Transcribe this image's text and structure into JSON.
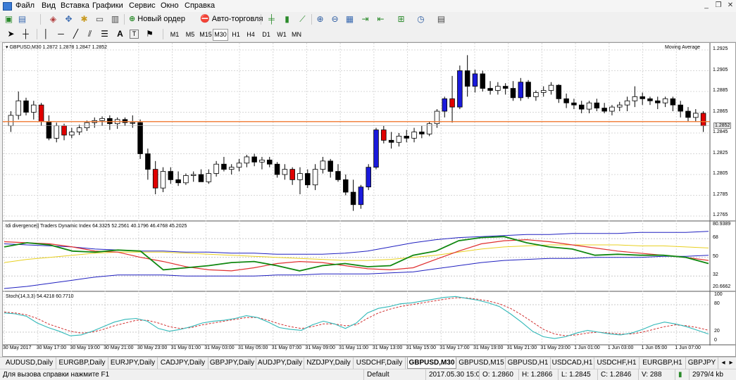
{
  "menu": [
    "Файл",
    "Вид",
    "Вставка",
    "Графики",
    "Сервис",
    "Окно",
    "Справка"
  ],
  "window_controls": {
    "minimize": "_",
    "restore": "❐",
    "close": "✕"
  },
  "toolbar1": {
    "new_order": "Новый ордер",
    "autotrading": "Авто-торговля"
  },
  "timeframes": [
    "M1",
    "M5",
    "M15",
    "M30",
    "H1",
    "H4",
    "D1",
    "W1",
    "MN"
  ],
  "active_timeframe": "M30",
  "drawing_tools": {
    "text_tool": "A",
    "label_tool": "T"
  },
  "chart": {
    "symbol_info": "GBPUSD,M30  1.2872 1.2878 1.2847 1.2852",
    "indicator_name": "Moving Average",
    "current_price": "1.2852",
    "price_ticks": [
      "1.2925",
      "1.2905",
      "1.2885",
      "1.2865",
      "1.2845",
      "1.2825",
      "1.2805",
      "1.2785",
      "1.2765"
    ],
    "tdi_label": "tdi divergence|| Traders Dynamic Index 64.3325 52.2561 40.1796 46.4768 45.2025",
    "tdi_ticks": [
      "80.9389",
      "68",
      "50",
      "32",
      "20.6662"
    ],
    "stoch_label": "Stoch(14,3,3) 54.4218 60.7710",
    "stoch_ticks": [
      "100",
      "80",
      "20",
      "0"
    ],
    "time_labels": [
      "30 May 2017",
      "30 May 17:00",
      "30 May 19:00",
      "30 May 21:00",
      "30 May 23:00",
      "31 May 01:00",
      "31 May 03:00",
      "31 May 05:00",
      "31 May 07:00",
      "31 May 09:00",
      "31 May 11:00",
      "31 May 13:00",
      "31 May 15:00",
      "31 May 17:00",
      "31 May 19:00",
      "31 May 21:00",
      "31 May 23:00",
      "1 Jun 01:00",
      "1 Jun 03:00",
      "1 Jun 05:00",
      "1 Jun 07:00"
    ],
    "colors": {
      "bull": "#ffffff",
      "bear": "#000000",
      "bear_signal": "#e00000",
      "bull_signal": "#1a1adc",
      "ma_line": "#f07830",
      "rsi": "#118811",
      "signal": "#e03030",
      "band": "#2020c0",
      "mid": "#e8d020"
    },
    "candles_data": {
      "comment": "OHLC approximations, read from the price axis",
      "ohlc": [
        [
          1.2852,
          1.2866,
          1.2846,
          1.2862
        ],
        [
          1.2862,
          1.2885,
          1.2858,
          1.2876
        ],
        [
          1.2876,
          1.2879,
          1.2862,
          1.2865
        ],
        [
          1.2865,
          1.2876,
          1.2858,
          1.2872
        ],
        [
          1.2872,
          1.2874,
          1.2852,
          1.2856
        ],
        [
          1.2856,
          1.2862,
          1.2838,
          1.284
        ],
        [
          1.284,
          1.2855,
          1.2836,
          1.2852
        ],
        [
          1.2852,
          1.2854,
          1.2838,
          1.2843
        ],
        [
          1.2843,
          1.285,
          1.284,
          1.2846
        ],
        [
          1.2846,
          1.2853,
          1.2843,
          1.285
        ],
        [
          1.285,
          1.2857,
          1.2847,
          1.2855
        ],
        [
          1.2855,
          1.286,
          1.285,
          1.2857
        ],
        [
          1.2857,
          1.2861,
          1.2852,
          1.2859
        ],
        [
          1.2859,
          1.2862,
          1.2848,
          1.2854
        ],
        [
          1.2854,
          1.286,
          1.2849,
          1.2858
        ],
        [
          1.2858,
          1.286,
          1.2852,
          1.2855
        ],
        [
          1.2855,
          1.2862,
          1.285,
          1.2855
        ],
        [
          1.2855,
          1.2858,
          1.282,
          1.2825
        ],
        [
          1.2825,
          1.283,
          1.28,
          1.281
        ],
        [
          1.281,
          1.2818,
          1.2786,
          1.2792
        ],
        [
          1.2792,
          1.2812,
          1.2788,
          1.2808
        ],
        [
          1.2808,
          1.2812,
          1.2796,
          1.28
        ],
        [
          1.28,
          1.2808,
          1.2794,
          1.2797
        ],
        [
          1.2797,
          1.2806,
          1.2795,
          1.2804
        ],
        [
          1.2804,
          1.2808,
          1.2798,
          1.2805
        ],
        [
          1.2805,
          1.281,
          1.2798,
          1.2798
        ],
        [
          1.2798,
          1.281,
          1.2796,
          1.2806
        ],
        [
          1.2806,
          1.2818,
          1.2803,
          1.2815
        ],
        [
          1.2815,
          1.2822,
          1.2808,
          1.281
        ],
        [
          1.281,
          1.2815,
          1.2805,
          1.2812
        ],
        [
          1.2812,
          1.282,
          1.2808,
          1.2816
        ],
        [
          1.2816,
          1.2824,
          1.2812,
          1.2822
        ],
        [
          1.2822,
          1.2825,
          1.2813,
          1.2817
        ],
        [
          1.2817,
          1.2822,
          1.281,
          1.2819
        ],
        [
          1.2819,
          1.2822,
          1.2812,
          1.2815
        ],
        [
          1.2815,
          1.2817,
          1.2802,
          1.2805
        ],
        [
          1.2805,
          1.2815,
          1.28,
          1.281
        ],
        [
          1.281,
          1.2812,
          1.2795,
          1.28
        ],
        [
          1.28,
          1.2812,
          1.2786,
          1.2806
        ],
        [
          1.2806,
          1.281,
          1.2792,
          1.2795
        ],
        [
          1.2795,
          1.2815,
          1.279,
          1.281
        ],
        [
          1.281,
          1.2822,
          1.2806,
          1.2818
        ],
        [
          1.2818,
          1.282,
          1.2802,
          1.2808
        ],
        [
          1.2808,
          1.2815,
          1.2798,
          1.28
        ],
        [
          1.28,
          1.2805,
          1.2785,
          1.2788
        ],
        [
          1.2788,
          1.28,
          1.277,
          1.2776
        ],
        [
          1.2776,
          1.2795,
          1.2772,
          1.2793
        ],
        [
          1.2793,
          1.2815,
          1.279,
          1.2812
        ],
        [
          1.2812,
          1.285,
          1.281,
          1.2848
        ],
        [
          1.2848,
          1.2852,
          1.2835,
          1.2838
        ],
        [
          1.2838,
          1.2846,
          1.283,
          1.2836
        ],
        [
          1.2836,
          1.2845,
          1.2832,
          1.2842
        ],
        [
          1.2842,
          1.2848,
          1.2836,
          1.284
        ],
        [
          1.284,
          1.285,
          1.2836,
          1.2846
        ],
        [
          1.2846,
          1.2852,
          1.284,
          1.2844
        ],
        [
          1.2844,
          1.2856,
          1.2842,
          1.2854
        ],
        [
          1.2854,
          1.2868,
          1.285,
          1.2866
        ],
        [
          1.2866,
          1.288,
          1.286,
          1.2878
        ],
        [
          1.2878,
          1.29,
          1.2855,
          1.287
        ],
        [
          1.287,
          1.291,
          1.2868,
          1.2905
        ],
        [
          1.2905,
          1.292,
          1.288,
          1.289
        ],
        [
          1.289,
          1.2906,
          1.2884,
          1.2902
        ],
        [
          1.2902,
          1.2905,
          1.2885,
          1.2888
        ],
        [
          1.2888,
          1.2895,
          1.2882,
          1.2886
        ],
        [
          1.2886,
          1.2894,
          1.2882,
          1.289
        ],
        [
          1.289,
          1.2893,
          1.2882,
          1.2888
        ],
        [
          1.2888,
          1.2895,
          1.2876,
          1.2879
        ],
        [
          1.2879,
          1.2898,
          1.2876,
          1.2894
        ],
        [
          1.2894,
          1.2896,
          1.2878,
          1.288
        ],
        [
          1.288,
          1.2886,
          1.2876,
          1.2884
        ],
        [
          1.2884,
          1.289,
          1.288,
          1.2886
        ],
        [
          1.2886,
          1.2894,
          1.2882,
          1.2891
        ],
        [
          1.2891,
          1.2892,
          1.2874,
          1.2878
        ],
        [
          1.2878,
          1.2883,
          1.2869,
          1.2874
        ],
        [
          1.2874,
          1.2878,
          1.2868,
          1.2872
        ],
        [
          1.2872,
          1.2876,
          1.2864,
          1.2868
        ],
        [
          1.2868,
          1.2876,
          1.2864,
          1.2874
        ],
        [
          1.2874,
          1.2878,
          1.2866,
          1.2869
        ],
        [
          1.2869,
          1.2874,
          1.2864,
          1.2866
        ],
        [
          1.2866,
          1.2872,
          1.2862,
          1.287
        ],
        [
          1.287,
          1.2875,
          1.2866,
          1.2872
        ],
        [
          1.2872,
          1.288,
          1.2866,
          1.2876
        ],
        [
          1.2876,
          1.289,
          1.287,
          1.288
        ],
        [
          1.288,
          1.2884,
          1.2872,
          1.2878
        ],
        [
          1.2878,
          1.288,
          1.2872,
          1.2876
        ],
        [
          1.2876,
          1.288,
          1.2868,
          1.2874
        ],
        [
          1.2874,
          1.288,
          1.287,
          1.2878
        ],
        [
          1.2878,
          1.288,
          1.2866,
          1.2872
        ],
        [
          1.2872,
          1.2876,
          1.286,
          1.2866
        ],
        [
          1.2866,
          1.287,
          1.2856,
          1.286
        ],
        [
          1.286,
          1.2868,
          1.2856,
          1.2864
        ],
        [
          1.2864,
          1.2866,
          1.2846,
          1.2852
        ]
      ]
    }
  },
  "tabs": [
    "AUDUSD,Daily",
    "EURGBP,Daily",
    "EURJPY,Daily",
    "CADJPY,Daily",
    "GBPJPY,Daily",
    "AUDJPY,Daily",
    "NZDJPY,Daily",
    "USDCHF,Daily",
    "GBPUSD,M30",
    "GBPUSD,M15",
    "GBPUSD,H1",
    "USDCAD,H1",
    "USDCHF,H1",
    "EURGBP,H1",
    "GBPJPY"
  ],
  "active_tab": "GBPUSD,M30",
  "status": {
    "help": "Для вызова справки нажмите F1",
    "profile": "Default",
    "datetime": "2017.05.30 15:00",
    "open": "O: 1.2860",
    "high": "H: 1.2866",
    "low": "L: 1.2845",
    "close": "C: 1.2846",
    "volume": "V: 288",
    "traffic": "2979/4 kb"
  }
}
